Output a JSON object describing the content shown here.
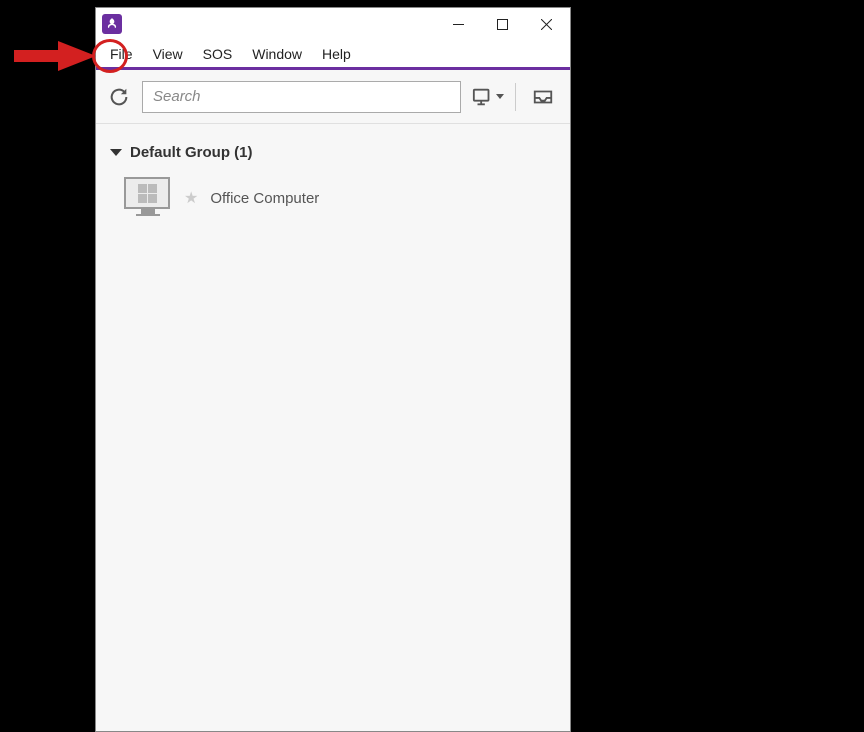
{
  "menu": {
    "file": "File",
    "view": "View",
    "sos": "SOS",
    "window": "Window",
    "help": "Help"
  },
  "toolbar": {
    "search_placeholder": "Search"
  },
  "group": {
    "title": "Default Group (1)"
  },
  "computers": [
    {
      "name": "Office Computer"
    }
  ],
  "colors": {
    "accent": "#6b2fa0",
    "annotation": "#d32020"
  }
}
